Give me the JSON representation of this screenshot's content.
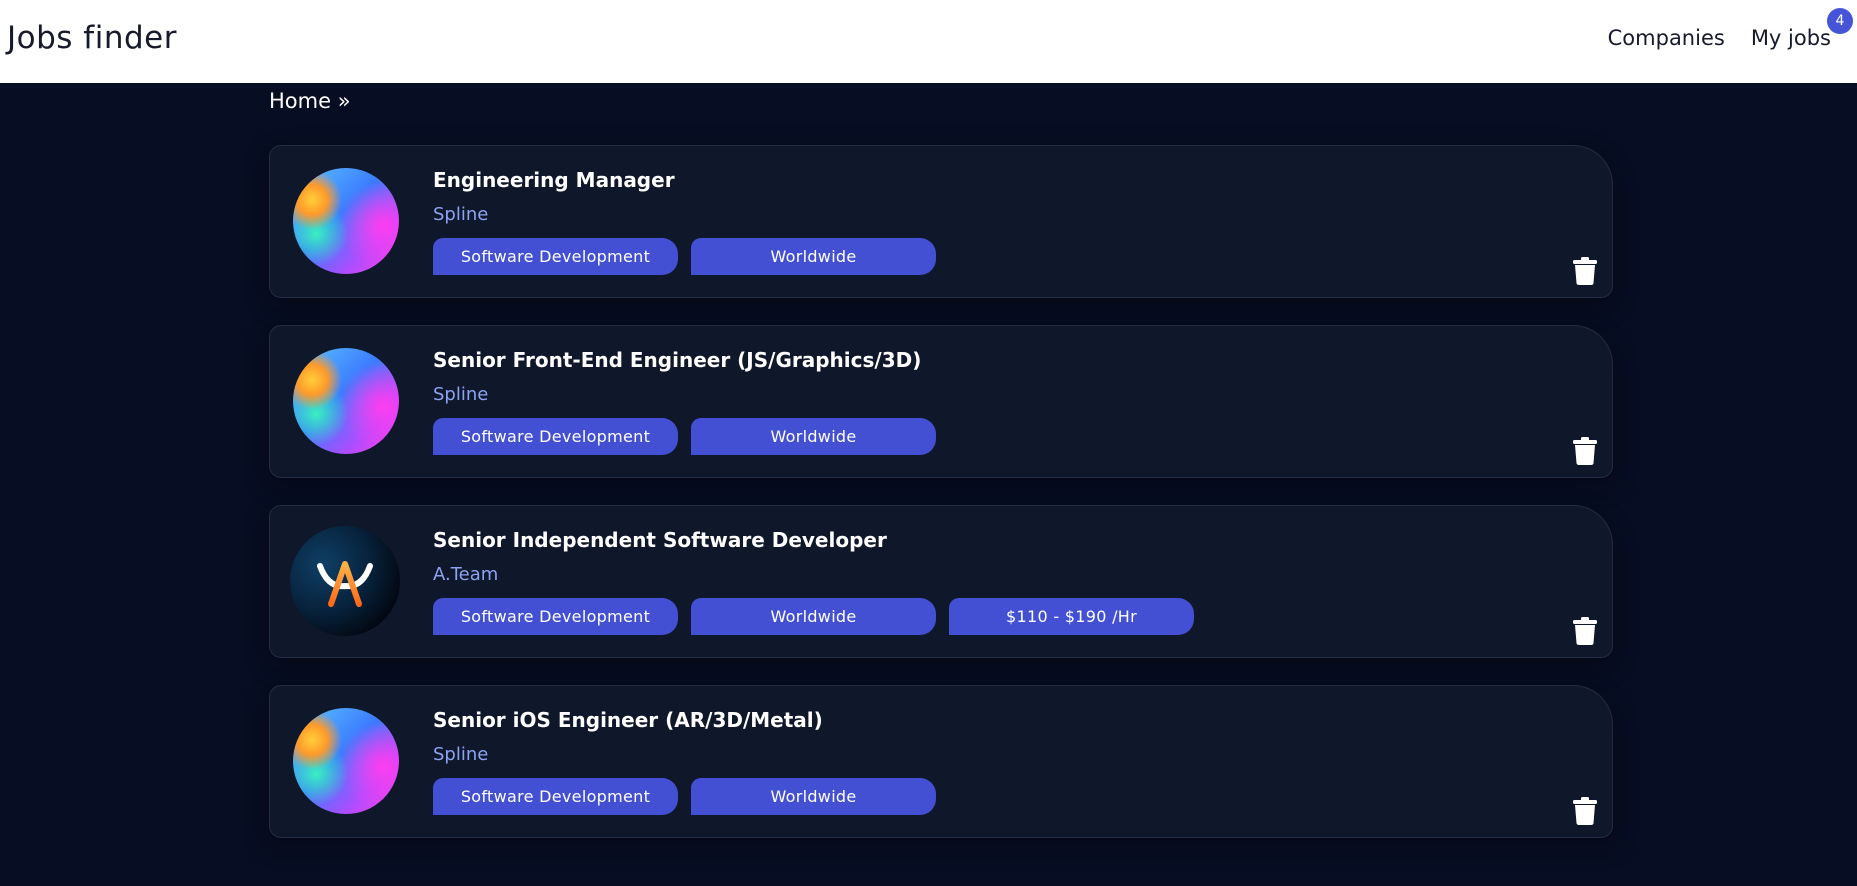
{
  "header": {
    "brand": "Jobs finder",
    "nav": {
      "companies": "Companies",
      "my_jobs": "My jobs",
      "my_jobs_count": "4"
    }
  },
  "breadcrumb": {
    "home": "Home »"
  },
  "jobs": [
    {
      "title": "Engineering Manager",
      "company": "Spline",
      "logo": "spline-logo",
      "tags": [
        "Software Development",
        "Worldwide"
      ]
    },
    {
      "title": "Senior Front-End Engineer (JS/Graphics/3D)",
      "company": "Spline",
      "logo": "spline-logo",
      "tags": [
        "Software Development",
        "Worldwide"
      ]
    },
    {
      "title": "Senior Independent Software Developer",
      "company": "A.Team",
      "logo": "ateam-logo",
      "tags": [
        "Software Development",
        "Worldwide",
        "$110 - $190 /Hr"
      ]
    },
    {
      "title": "Senior iOS Engineer (AR/3D/Metal)",
      "company": "Spline",
      "logo": "spline-logo",
      "tags": [
        "Software Development",
        "Worldwide"
      ]
    }
  ],
  "icons": {
    "delete": "trash-icon"
  },
  "colors": {
    "background": "#070d22",
    "card": "#0f172b",
    "tag": "#4450d4",
    "company_text": "#8da3f2",
    "badge": "#4654d8"
  }
}
